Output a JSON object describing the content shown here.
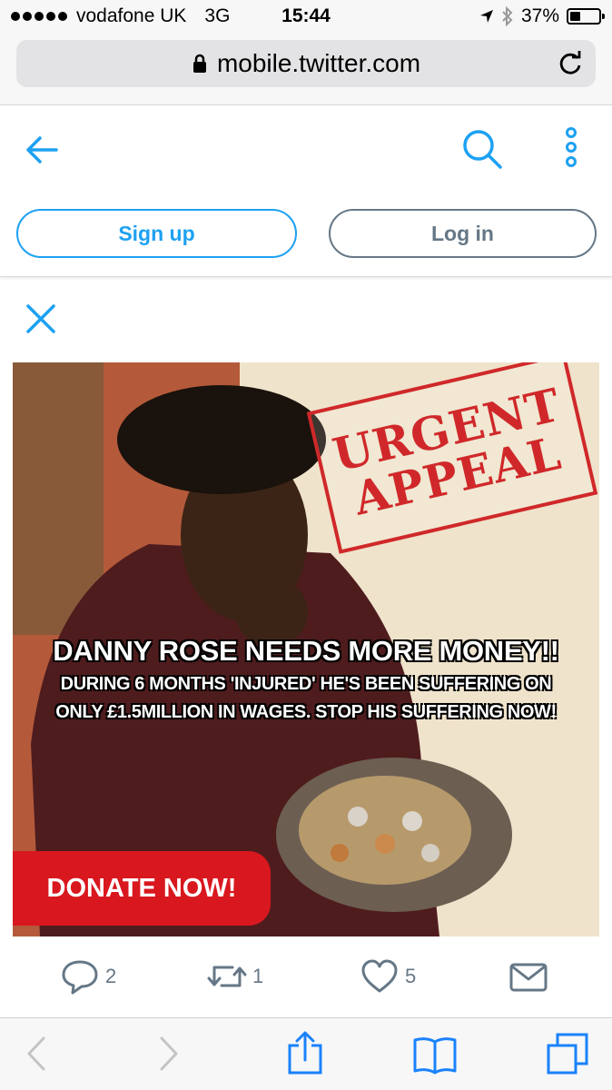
{
  "status_bar": {
    "carrier": "vodafone UK",
    "network": "3G",
    "time": "15:44",
    "battery": "37%",
    "battery_level": 0.37
  },
  "browser": {
    "url": "mobile.twitter.com"
  },
  "header": {
    "signup_label": "Sign up",
    "login_label": "Log in"
  },
  "media": {
    "stamp_line1": "URGENT",
    "stamp_line2": "APPEAL",
    "headline": "DANNY ROSE NEEDS MORE MONEY!!",
    "subline1": "DURING 6 MONTHS 'INJURED' HE'S BEEN SUFFERING ON",
    "subline2": "ONLY £1.5MILLION IN WAGES. STOP HIS SUFFERING NOW!",
    "donate_label": "DONATE NOW!"
  },
  "actions": {
    "reply_count": "2",
    "retweet_count": "1",
    "like_count": "5"
  },
  "colors": {
    "twitter_blue": "#1da1f2",
    "gray": "#657786",
    "safari_blue": "#1a82fb",
    "stamp_red": "#d0282a",
    "donate_red": "#d9171e"
  }
}
